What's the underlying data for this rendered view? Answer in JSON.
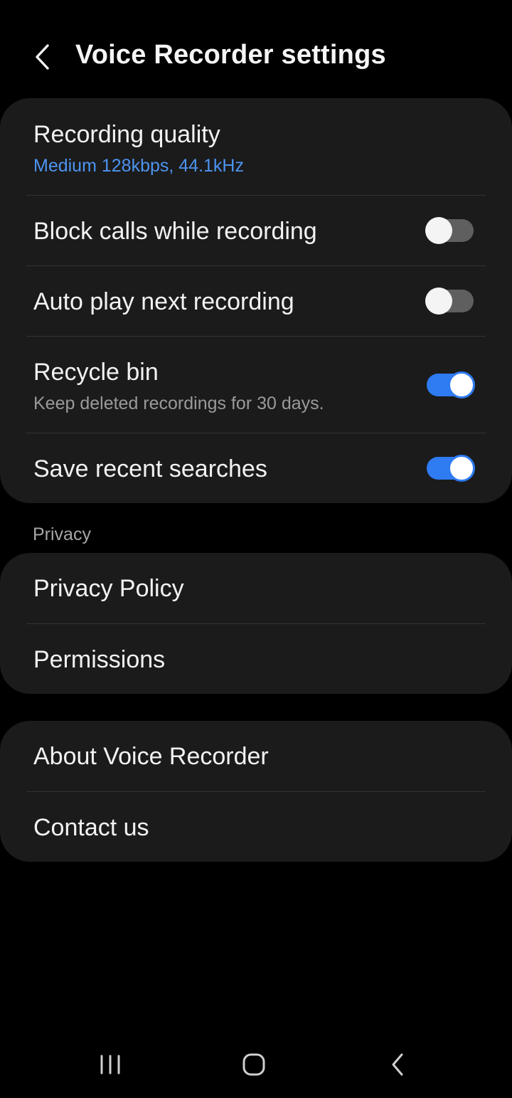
{
  "header": {
    "title": "Voice Recorder settings",
    "back_icon": "chevron-left-icon"
  },
  "settings": {
    "recording_quality": {
      "label": "Recording quality",
      "value": "Medium 128kbps, 44.1kHz"
    },
    "block_calls": {
      "label": "Block calls while recording",
      "enabled": false
    },
    "auto_play": {
      "label": "Auto play next recording",
      "enabled": false
    },
    "recycle_bin": {
      "label": "Recycle bin",
      "description": "Keep deleted recordings for 30 days.",
      "enabled": true
    },
    "save_searches": {
      "label": "Save recent searches",
      "enabled": true
    }
  },
  "privacy": {
    "section_label": "Privacy",
    "items": [
      {
        "label": "Privacy Policy"
      },
      {
        "label": "Permissions"
      }
    ]
  },
  "about": {
    "items": [
      {
        "label": "About Voice Recorder"
      },
      {
        "label": "Contact us"
      }
    ]
  },
  "colors": {
    "background": "#000000",
    "card": "#1b1b1b",
    "accent": "#2e7bf2",
    "accent_text": "#4d94f0",
    "switch_off_track": "#5f5f5f"
  },
  "navigation_bar": {
    "recents_icon": "recent-apps-icon",
    "home_icon": "home-icon",
    "back_icon": "back-icon"
  }
}
